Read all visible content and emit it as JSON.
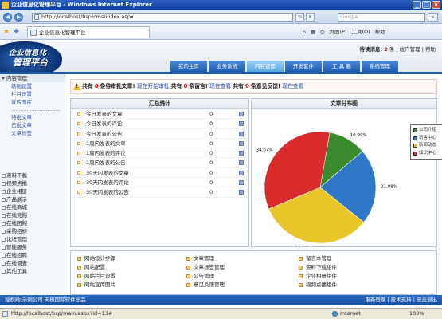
{
  "window": {
    "title": "企业信息化管理平台 - Windows Internet Explorer"
  },
  "browser": {
    "url": "http://localhost/bsp/cms/index.aspx",
    "search_placeholder": "Google",
    "tab_title": "企业信息化管理平台",
    "commands": [
      "页面(P)",
      "工具(O)",
      "帮助"
    ]
  },
  "header": {
    "logo_line1": "企业信息化",
    "logo_line2": "管理平台",
    "welcome": "待读消息:",
    "msg_count": "2",
    "links": "条 | 帐户管理 | 帮助",
    "nav": [
      "我的主页",
      "业务系统",
      "内容管理",
      "开发套件",
      "工 具 箱",
      "系统管理"
    ],
    "active_nav": "内容管理"
  },
  "sidebar": {
    "open_group": "内容管理",
    "items_a": [
      "基础设置",
      "栏目设置",
      "宣传图片"
    ],
    "items_b": [
      "待批文章",
      "已批文章",
      "文章标签"
    ],
    "groups": [
      "资料下载",
      "视频点播",
      "企业相册",
      "产品展示",
      "在线商城",
      "在线竞购",
      "在线团购",
      "采购招标",
      "论坛管理",
      "智能服务",
      "在线招聘",
      "在线调查",
      "其他工具"
    ]
  },
  "notice": {
    "p1": "共有",
    "n1": "0",
    "p2": "条待审批文章!",
    "l1": "现在开始审批",
    "p3": "共有",
    "n2": "0",
    "p4": "条留言!",
    "l2": "现在查看",
    "p5": "共有",
    "n3": "0",
    "p6": "条意见反馈!",
    "l3": "现在查看"
  },
  "stats": {
    "title": "汇总统计",
    "rows": [
      {
        "label": "今日发表的文章",
        "count": "0"
      },
      {
        "label": "今日发表的评论",
        "count": "0"
      },
      {
        "label": "今日发表的公告",
        "count": "0"
      },
      {
        "label": "1周内发表的文章",
        "count": "0"
      },
      {
        "label": "1周内发表的评论",
        "count": "0"
      },
      {
        "label": "1周内发表的公告",
        "count": "0"
      },
      {
        "label": "30天内发表的文章",
        "count": "0"
      },
      {
        "label": "30天内发表的评论",
        "count": "0"
      },
      {
        "label": "30天内发表的公告",
        "count": "0"
      }
    ]
  },
  "chart_data": {
    "type": "pie",
    "title": "文章分布图",
    "categories": [
      "公司介绍",
      "销售中心",
      "新闻动态",
      "知识中心"
    ],
    "values": [
      10.99,
      21.98,
      32.97,
      34.07
    ],
    "labels": [
      "10.99%",
      "21.98%",
      "32.97%",
      "34.07%"
    ],
    "colors": [
      "#3a8a2e",
      "#2f78c8",
      "#e8c528",
      "#d92b2b"
    ],
    "legend_position": "right"
  },
  "quick": {
    "col1": [
      "网站设计步骤",
      "网站配置",
      "网站栏目设置",
      "网站宣传图片"
    ],
    "col2": [
      "文章管理",
      "文章标签管理",
      "公告管理",
      "意见反馈管理"
    ],
    "col3": [
      "留言本管理",
      "资料下载组件",
      "企业相册组件",
      "视频点播组件"
    ]
  },
  "footer": {
    "left": "授权给:示例公司    天极国际软件出品",
    "right": "重新登录 | 技术支持 | 安全退出"
  },
  "status": {
    "text": "http://localhost/bsp/main.aspx?id=13#",
    "zone": "Internet",
    "zoom": "100%"
  }
}
